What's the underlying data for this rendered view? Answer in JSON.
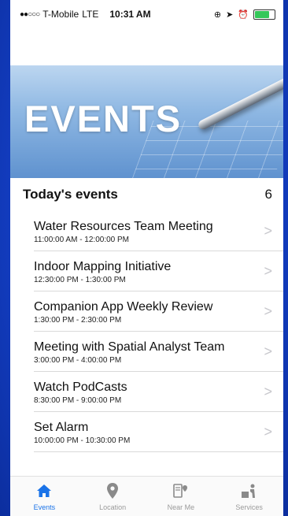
{
  "status_bar": {
    "carrier": "T-Mobile",
    "network": "LTE",
    "time": "10:31 AM"
  },
  "hero": {
    "title": "EVENTS"
  },
  "section": {
    "title": "Today's events",
    "count": "6"
  },
  "events": [
    {
      "name": "Water Resources Team Meeting",
      "time": "11:00:00 AM - 12:00:00 PM"
    },
    {
      "name": "Indoor Mapping Initiative",
      "time": "12:30:00 PM - 1:30:00 PM"
    },
    {
      "name": "Companion App Weekly Review",
      "time": "1:30:00 PM - 2:30:00 PM"
    },
    {
      "name": "Meeting with Spatial Analyst Team",
      "time": "3:00:00 PM - 4:00:00 PM"
    },
    {
      "name": "Watch PodCasts",
      "time": "8:30:00 PM - 9:00:00 PM"
    },
    {
      "name": "Set Alarm",
      "time": "10:00:00 PM - 10:30:00 PM"
    }
  ],
  "tabs": [
    {
      "label": "Events",
      "icon": "home-icon",
      "active": true
    },
    {
      "label": "Location",
      "icon": "location-pin-icon",
      "active": false
    },
    {
      "label": "Near Me",
      "icon": "near-me-icon",
      "active": false
    },
    {
      "label": "Services",
      "icon": "services-icon",
      "active": false
    }
  ],
  "colors": {
    "accent": "#1a73e8",
    "background_frame": "#1a4bd6"
  }
}
